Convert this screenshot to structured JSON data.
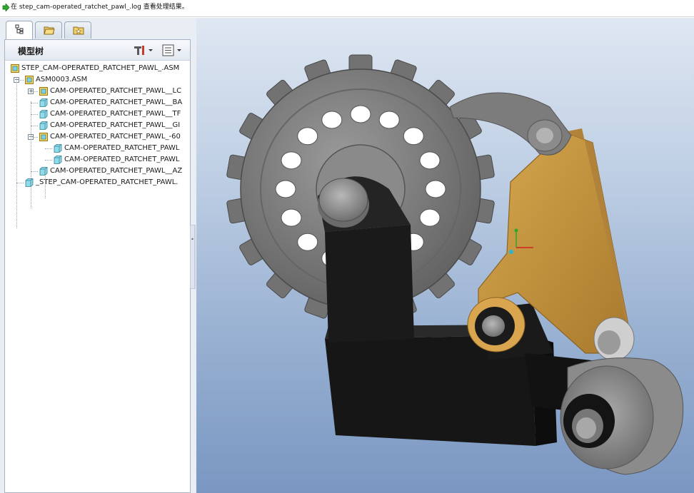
{
  "message_bar": {
    "text": "在 step_cam-operated_ratchet_pawl_.log 查看处理结果。"
  },
  "left_panel": {
    "tabs": [
      {
        "name": "model-tree-tab",
        "icon": "model-tree-icon",
        "active": true
      },
      {
        "name": "folder-browser-tab",
        "icon": "folder-browser-icon",
        "active": false
      },
      {
        "name": "favorites-tab",
        "icon": "favorites-icon",
        "active": false
      }
    ],
    "title": "模型树",
    "toolbar": {
      "settings_icon": "tree-settings-icon",
      "columns_icon": "tree-columns-icon"
    },
    "tree": [
      {
        "label": "STEP_CAM-OPERATED_RATCHET_PAWL_.ASM",
        "icon": "assembly-icon",
        "level": 0
      },
      {
        "label": "ASM0003.ASM",
        "icon": "assembly-icon",
        "level": 1,
        "expander": "−"
      },
      {
        "label": "CAM-OPERATED_RATCHET_PAWL__LC",
        "icon": "assembly-icon",
        "level": 2,
        "expander": "+"
      },
      {
        "label": "CAM-OPERATED_RATCHET_PAWL__BA",
        "icon": "part-icon",
        "level": 2
      },
      {
        "label": "CAM-OPERATED_RATCHET_PAWL__TF",
        "icon": "part-icon",
        "level": 2
      },
      {
        "label": "CAM-OPERATED_RATCHET_PAWL__GI",
        "icon": "part-icon",
        "level": 2
      },
      {
        "label": "CAM-OPERATED_RATCHET_PAWL_-60",
        "icon": "assembly-icon",
        "level": 2,
        "expander": "−"
      },
      {
        "label": "CAM-OPERATED_RATCHET_PAWL",
        "icon": "part-icon",
        "level": 3
      },
      {
        "label": "CAM-OPERATED_RATCHET_PAWL",
        "icon": "part-icon",
        "level": 3
      },
      {
        "label": "CAM-OPERATED_RATCHET_PAWL__AZ",
        "icon": "part-icon",
        "level": 2
      },
      {
        "label": "_STEP_CAM-OPERATED_RATCHET_PAWL.",
        "icon": "part-icon",
        "level": 1
      }
    ]
  },
  "viewport": {
    "model": "cam-operated ratchet pawl assembly",
    "colors": {
      "gear": "#7d7d7d",
      "frame": "#1e1e1e",
      "pawl": "#c8963c",
      "bg_top": "#dfe7f2",
      "bg_bottom": "#7a97c2"
    }
  }
}
